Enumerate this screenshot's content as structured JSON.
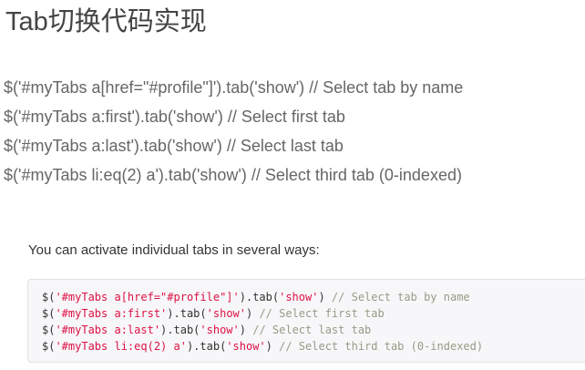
{
  "title": "Tab切换代码实现",
  "lines": [
    "$('#myTabs a[href=\"#profile\"]').tab('show') // Select tab by name",
    "$('#myTabs a:first').tab('show') // Select first tab",
    "$('#myTabs a:last').tab('show') // Select last tab",
    "$('#myTabs li:eq(2) a').tab('show') // Select third tab (0-indexed)"
  ],
  "intro": "You can activate individual tabs in several ways:",
  "code_block": [
    {
      "prefix": "$(",
      "selector": "'#myTabs a[href=\"#profile\"]'",
      "mid": ").tab(",
      "arg": "'show'",
      "close": ") ",
      "comment": "// Select tab by name"
    },
    {
      "prefix": "$(",
      "selector": "'#myTabs a:first'",
      "mid": ").tab(",
      "arg": "'show'",
      "close": ") ",
      "comment": "// Select first tab"
    },
    {
      "prefix": "$(",
      "selector": "'#myTabs a:last'",
      "mid": ").tab(",
      "arg": "'show'",
      "close": ") ",
      "comment": "// Select last tab"
    },
    {
      "prefix": "$(",
      "selector": "'#myTabs li:eq(2) a'",
      "mid": ").tab(",
      "arg": "'show'",
      "close": ") ",
      "comment": "// Select third tab (0-indexed)"
    }
  ],
  "colors": {
    "string": "#dd1144",
    "comment": "#999988",
    "code_background": "#f7f7f9",
    "code_border": "#e1e1e8"
  }
}
